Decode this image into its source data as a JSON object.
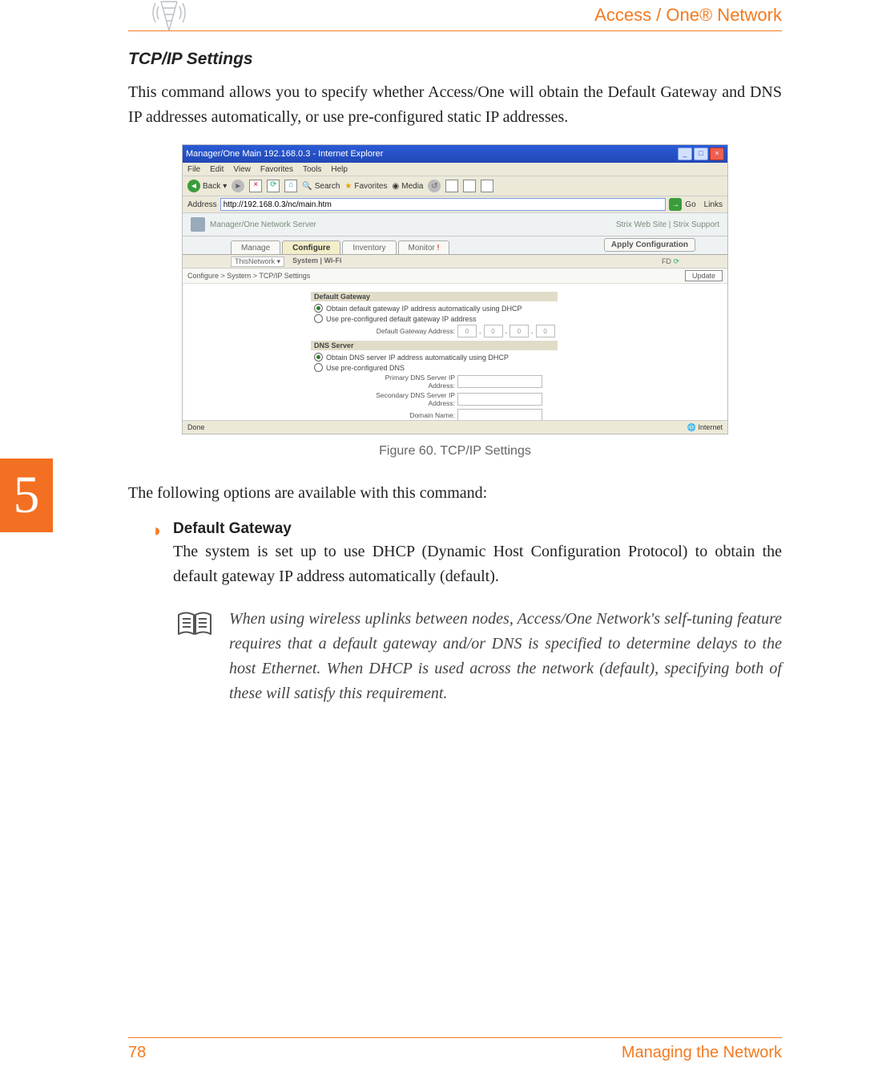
{
  "header": {
    "brand": "Access / One® Network"
  },
  "section": {
    "title": "TCP/IP Settings",
    "intro": "This command allows you to specify whether Access/One will obtain the Default Gateway and DNS IP addresses automatically, or use pre-configured static IP addresses."
  },
  "screenshot": {
    "window_title": "Manager/One Main 192.168.0.3 - Internet Explorer",
    "menus": [
      "File",
      "Edit",
      "View",
      "Favorites",
      "Tools",
      "Help"
    ],
    "toolbar": {
      "back": "Back",
      "search": "Search",
      "favorites": "Favorites",
      "media": "Media"
    },
    "address_label": "Address",
    "address_url": "http://192.168.0.3/nc/main.htm",
    "go_label": "Go",
    "links_label": "Links",
    "app_title": "Manager/One Network Server",
    "header_links": "Strix Web Site  |  Strix Support",
    "tabs": [
      "Manage",
      "Configure",
      "Inventory",
      "Monitor"
    ],
    "apply_btn": "Apply Configuration",
    "subnav_left": "System  |  Wi-Fi",
    "subnav_right": "FD",
    "breadcrumb": "Configure > System > TCP/IP Settings",
    "update_btn": "Update",
    "gateway": {
      "header": "Default Gateway",
      "opt1": "Obtain default gateway IP address automatically using DHCP",
      "opt2": "Use pre-configured default gateway IP address",
      "addr_label": "Default Gateway Address:",
      "octets": [
        "0",
        "0",
        "0",
        "0"
      ]
    },
    "dns": {
      "header": "DNS Server",
      "opt1": "Obtain DNS server IP address automatically using DHCP",
      "opt2": "Use pre-configured DNS",
      "primary_label": "Primary DNS Server IP Address:",
      "secondary_label": "Secondary DNS Server IP Address:",
      "domain_label": "Domain Name:"
    },
    "status_left": "Done",
    "status_right": "Internet"
  },
  "figure_caption": "Figure 60. TCP/IP Settings",
  "following_line": "The following options are available with this command:",
  "option": {
    "title": "Default Gateway",
    "text": "The system is set up to use DHCP (Dynamic Host Configuration Protocol) to obtain the default gateway IP address automatically (default)."
  },
  "note": "When using wireless uplinks between nodes, Access/One Network's self-tuning feature requires that a default gateway and/or DNS is specified to determine delays to the host Ethernet. When DHCP is used across the network (default), specifying both of these will satisfy this requirement.",
  "chapter_number": "5",
  "footer": {
    "page": "78",
    "title": "Managing the Network"
  }
}
